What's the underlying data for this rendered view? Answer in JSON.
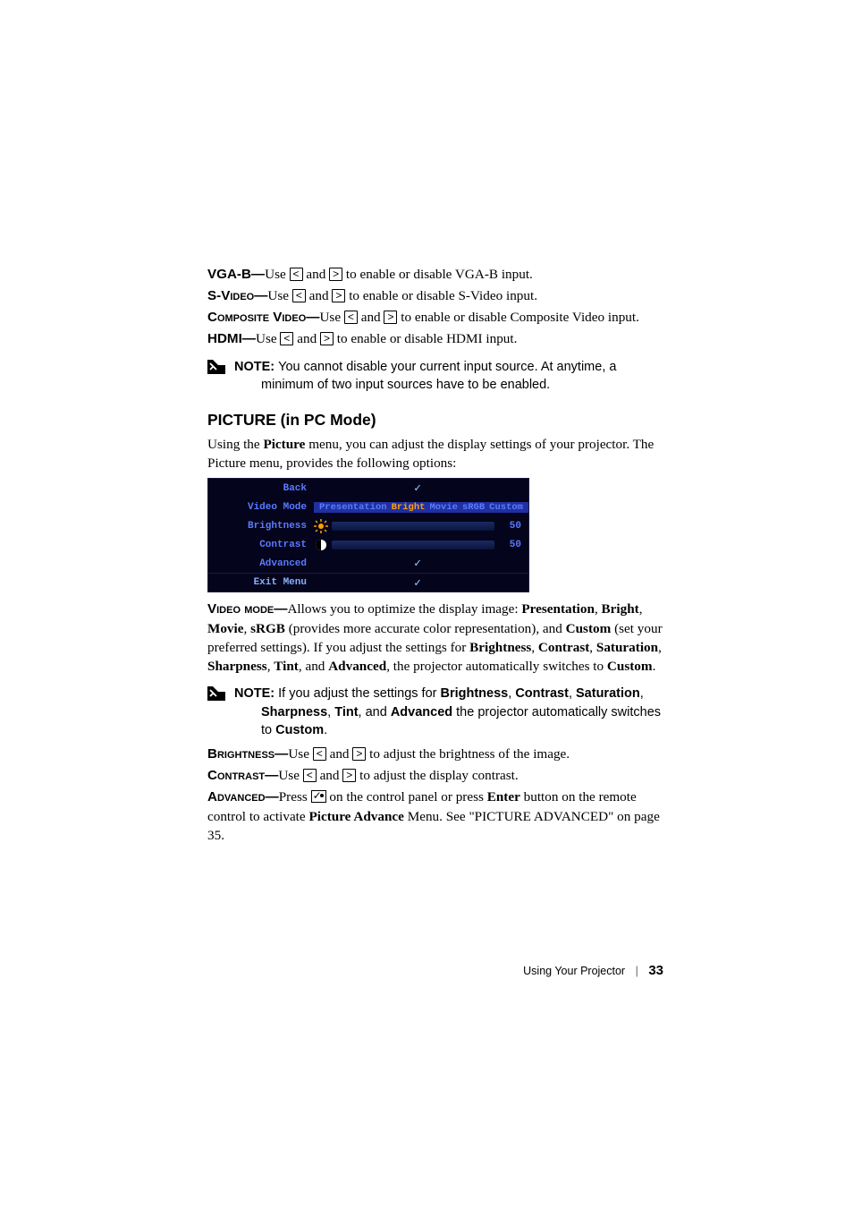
{
  "items": {
    "vgaB": {
      "label": "VGA-B—",
      "text": "Use ",
      "and": " and ",
      "rest": " to enable or disable VGA-B input."
    },
    "svideo": {
      "label": "S-Video—",
      "text": "Use ",
      "and": " and ",
      "rest": " to enable or disable S-Video input."
    },
    "composite": {
      "label": "Composite Video—",
      "text": "Use ",
      "and": " and ",
      "rest": " to enable or disable Composite Video input."
    },
    "hdmi": {
      "label": "HDMI—",
      "text": "Use ",
      "and": " and ",
      "rest": " to enable or disable HDMI input."
    }
  },
  "note1": {
    "label": " NOTE: ",
    "text": "You cannot disable your current input source. At anytime, a minimum of two input sources have to be enabled."
  },
  "section": "PICTURE (in PC Mode)",
  "intro": {
    "a": "Using the ",
    "b": "Picture",
    "c": " menu, you can adjust the display settings of your projector. The Picture menu, provides the following options:"
  },
  "osd": {
    "back": "Back",
    "videoMode": "Video Mode",
    "modes": {
      "presentation": "Presentation",
      "bright": "Bright",
      "movie": "Movie",
      "srgb": "sRGB",
      "custom": "Custom"
    },
    "brightness": {
      "label": "Brightness",
      "value": "50"
    },
    "contrast": {
      "label": "Contrast",
      "value": "50"
    },
    "advanced": "Advanced",
    "exit": "Exit Menu"
  },
  "videoModePara": {
    "label": "Video mode—",
    "a": "Allows you to optimize the display image: ",
    "p": "Presentation",
    "c1": ", ",
    "b": "Bright",
    "c2": ", ",
    "m": "Movie",
    "c3": ", ",
    "s": "sRGB",
    "d": " (provides more accurate color representation), and ",
    "cu": "Custom",
    "e": " (set your preferred settings). If you adjust the settings for ",
    "br": "Brightness",
    "c4": ", ",
    "co": "Contrast",
    "c5": ", ",
    "sa": "Saturation",
    "c6": ", ",
    "sh": "Sharpness",
    "c7": ", ",
    "ti": "Tint",
    "c8": ", and ",
    "ad": "Advanced",
    "f": ", the projector automatically switches to ",
    "cu2": "Custom",
    "g": "."
  },
  "note2": {
    "label": " NOTE: ",
    "a": "If you adjust the settings for ",
    "br": "Brightness",
    "c1": ", ",
    "co": "Contrast",
    "c2": ", ",
    "sa": "Saturation",
    "c3": ", ",
    "sh": "Sharpness",
    "c4": ", ",
    "ti": "Tint",
    "c5": ", and ",
    "ad": "Advanced",
    "b": " the projector automatically switches to ",
    "cu": "Custom",
    "d": "."
  },
  "brightnessLine": {
    "label": "Brightness—",
    "a": "Use ",
    "and": " and ",
    "rest": " to adjust the brightness of the image."
  },
  "contrastLine": {
    "label": "Contrast—",
    "a": "Use ",
    "and": " and ",
    "rest": " to adjust the display contrast."
  },
  "advancedLine": {
    "label": "Advanced—",
    "a": "Press ",
    "b": " on the control panel or press ",
    "enter": "Enter",
    "c": " button on the remote control to activate ",
    "menu": "Picture Advance",
    "d": " Menu. See \"PICTURE ADVANCED\" on page 35."
  },
  "keys": {
    "left": "<",
    "right": ">"
  },
  "footer": {
    "text": "Using Your Projector",
    "page": "33"
  }
}
